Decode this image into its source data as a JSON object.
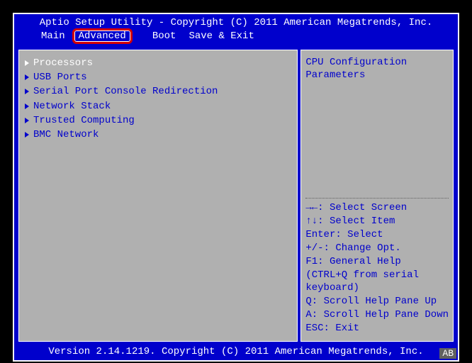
{
  "header": {
    "title": "Aptio Setup Utility - Copyright (C) 2011 American Megatrends, Inc."
  },
  "tabs": [
    {
      "label": "Main",
      "active": false
    },
    {
      "label": "Advanced",
      "active": true
    },
    {
      "label": "",
      "active": false
    },
    {
      "label": "Boot",
      "active": false
    },
    {
      "label": "Save & Exit",
      "active": false
    }
  ],
  "menu": {
    "items": [
      {
        "label": "Processors",
        "selected": true
      },
      {
        "label": "USB Ports",
        "selected": false
      },
      {
        "label": "Serial Port Console Redirection",
        "selected": false
      },
      {
        "label": "Network Stack",
        "selected": false
      },
      {
        "label": "Trusted Computing",
        "selected": false
      },
      {
        "label": "BMC Network",
        "selected": false
      }
    ]
  },
  "help": {
    "line1": "CPU Configuration",
    "line2": "Parameters"
  },
  "hints": [
    {
      "key": "→←:",
      "text": "Select Screen"
    },
    {
      "key": "↑↓:",
      "text": "Select Item"
    },
    {
      "key": "Enter:",
      "text": "Select"
    },
    {
      "key": "+/-:",
      "text": "Change Opt."
    },
    {
      "key": "F1:",
      "text": "General Help"
    },
    {
      "key": "",
      "text": "(CTRL+Q from serial keyboard)"
    },
    {
      "key": "Q:",
      "text": "Scroll Help Pane Up"
    },
    {
      "key": "A:",
      "text": "Scroll Help Pane Down"
    },
    {
      "key": "ESC:",
      "text": "Exit"
    }
  ],
  "footer": {
    "version": "Version 2.14.1219. Copyright (C) 2011 American Megatrends, Inc.",
    "badge": "AB"
  }
}
